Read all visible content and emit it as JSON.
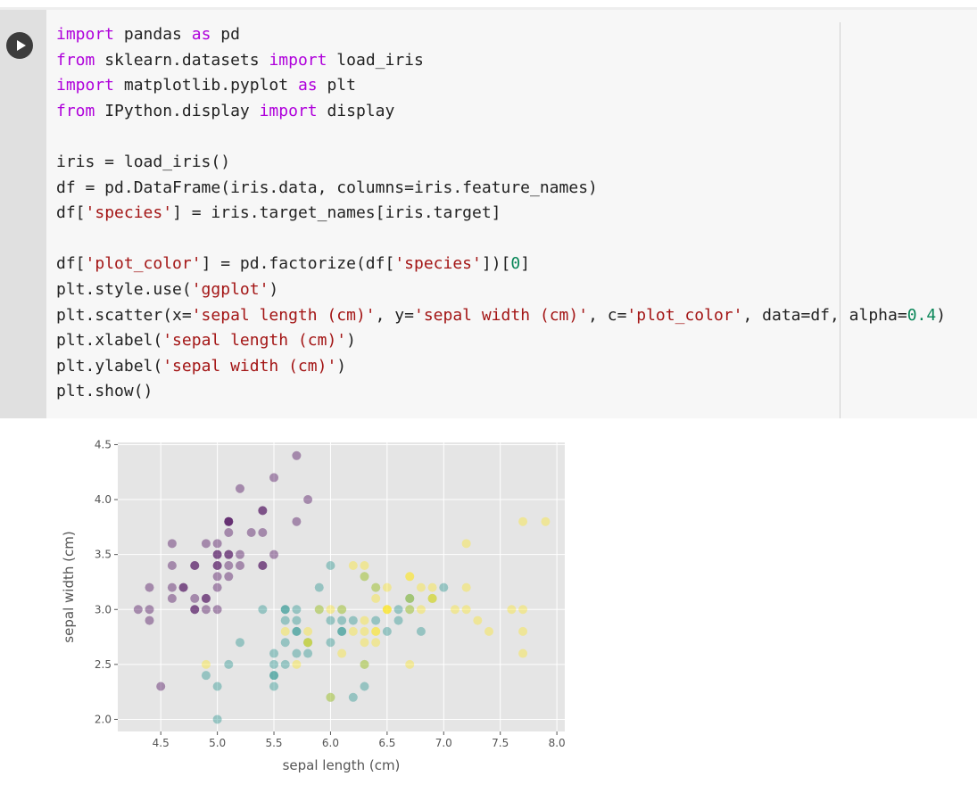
{
  "cell": {
    "run_button": "play-icon",
    "code_lines": [
      [
        {
          "t": "import",
          "c": "kw"
        },
        {
          "t": " pandas ",
          "c": "plain"
        },
        {
          "t": "as",
          "c": "kw"
        },
        {
          "t": " pd",
          "c": "plain"
        }
      ],
      [
        {
          "t": "from",
          "c": "kw"
        },
        {
          "t": " sklearn.datasets ",
          "c": "plain"
        },
        {
          "t": "import",
          "c": "kw"
        },
        {
          "t": " load_iris",
          "c": "plain"
        }
      ],
      [
        {
          "t": "import",
          "c": "kw"
        },
        {
          "t": " matplotlib.pyplot ",
          "c": "plain"
        },
        {
          "t": "as",
          "c": "kw"
        },
        {
          "t": " plt",
          "c": "plain"
        }
      ],
      [
        {
          "t": "from",
          "c": "kw"
        },
        {
          "t": " IPython.display ",
          "c": "plain"
        },
        {
          "t": "import",
          "c": "kw"
        },
        {
          "t": " display",
          "c": "plain"
        }
      ],
      [],
      [
        {
          "t": "iris = load_iris()",
          "c": "plain"
        }
      ],
      [
        {
          "t": "df = pd.DataFrame(iris.data, columns=iris.feature_names)",
          "c": "plain"
        }
      ],
      [
        {
          "t": "df[",
          "c": "plain"
        },
        {
          "t": "'species'",
          "c": "str"
        },
        {
          "t": "] = iris.target_names[iris.target]",
          "c": "plain"
        }
      ],
      [],
      [
        {
          "t": "df[",
          "c": "plain"
        },
        {
          "t": "'plot_color'",
          "c": "str"
        },
        {
          "t": "] = pd.factorize(df[",
          "c": "plain"
        },
        {
          "t": "'species'",
          "c": "str"
        },
        {
          "t": "])[",
          "c": "plain"
        },
        {
          "t": "0",
          "c": "num"
        },
        {
          "t": "]",
          "c": "plain"
        }
      ],
      [
        {
          "t": "plt.style.use(",
          "c": "plain"
        },
        {
          "t": "'ggplot'",
          "c": "str"
        },
        {
          "t": ")",
          "c": "plain"
        }
      ],
      [
        {
          "t": "plt.scatter(x=",
          "c": "plain"
        },
        {
          "t": "'sepal length (cm)'",
          "c": "str"
        },
        {
          "t": ", y=",
          "c": "plain"
        },
        {
          "t": "'sepal width (cm)'",
          "c": "str"
        },
        {
          "t": ", c=",
          "c": "plain"
        },
        {
          "t": "'plot_color'",
          "c": "str"
        },
        {
          "t": ", data=df, alpha=",
          "c": "plain"
        },
        {
          "t": "0.4",
          "c": "num"
        },
        {
          "t": ")",
          "c": "plain"
        }
      ],
      [
        {
          "t": "plt.xlabel(",
          "c": "plain"
        },
        {
          "t": "'sepal length (cm)'",
          "c": "str"
        },
        {
          "t": ")",
          "c": "plain"
        }
      ],
      [
        {
          "t": "plt.ylabel(",
          "c": "plain"
        },
        {
          "t": "'sepal width (cm)'",
          "c": "str"
        },
        {
          "t": ")",
          "c": "plain"
        }
      ],
      [
        {
          "t": "plt.show()",
          "c": "plain"
        }
      ]
    ]
  },
  "chart_data": {
    "type": "scatter",
    "xlabel": "sepal length (cm)",
    "ylabel": "sepal width (cm)",
    "xlim": [
      4.12,
      8.07
    ],
    "ylim": [
      1.89,
      4.52
    ],
    "xticks": [
      "4.5",
      "5.0",
      "5.5",
      "6.0",
      "6.5",
      "7.0",
      "7.5",
      "8.0"
    ],
    "yticks": [
      "2.0",
      "2.5",
      "3.0",
      "3.5",
      "4.0",
      "4.5"
    ],
    "grid": true,
    "style": "ggplot",
    "alpha": 0.4,
    "colors": [
      "#440154",
      "#21918c",
      "#fde725"
    ],
    "background": "#e5e5e5",
    "series": [
      {
        "color_index": 0,
        "points": [
          [
            5.1,
            3.5
          ],
          [
            4.9,
            3.0
          ],
          [
            4.7,
            3.2
          ],
          [
            4.6,
            3.1
          ],
          [
            5.0,
            3.6
          ],
          [
            5.4,
            3.9
          ],
          [
            4.6,
            3.4
          ],
          [
            5.0,
            3.4
          ],
          [
            4.4,
            2.9
          ],
          [
            4.9,
            3.1
          ],
          [
            5.4,
            3.7
          ],
          [
            4.8,
            3.4
          ],
          [
            4.8,
            3.0
          ],
          [
            4.3,
            3.0
          ],
          [
            5.8,
            4.0
          ],
          [
            5.7,
            4.4
          ],
          [
            5.4,
            3.9
          ],
          [
            5.1,
            3.5
          ],
          [
            5.7,
            3.8
          ],
          [
            5.1,
            3.8
          ],
          [
            5.4,
            3.4
          ],
          [
            5.1,
            3.7
          ],
          [
            4.6,
            3.6
          ],
          [
            5.1,
            3.3
          ],
          [
            4.8,
            3.4
          ],
          [
            5.0,
            3.0
          ],
          [
            5.0,
            3.4
          ],
          [
            5.2,
            3.5
          ],
          [
            5.2,
            3.4
          ],
          [
            4.7,
            3.2
          ],
          [
            4.8,
            3.1
          ],
          [
            5.4,
            3.4
          ],
          [
            5.2,
            4.1
          ],
          [
            5.5,
            4.2
          ],
          [
            4.9,
            3.1
          ],
          [
            5.0,
            3.2
          ],
          [
            5.5,
            3.5
          ],
          [
            4.9,
            3.6
          ],
          [
            4.4,
            3.0
          ],
          [
            5.1,
            3.4
          ],
          [
            5.0,
            3.5
          ],
          [
            4.5,
            2.3
          ],
          [
            4.4,
            3.2
          ],
          [
            5.0,
            3.5
          ],
          [
            5.1,
            3.8
          ],
          [
            4.8,
            3.0
          ],
          [
            5.1,
            3.8
          ],
          [
            4.6,
            3.2
          ],
          [
            5.3,
            3.7
          ],
          [
            5.0,
            3.3
          ]
        ]
      },
      {
        "color_index": 1,
        "points": [
          [
            7.0,
            3.2
          ],
          [
            6.4,
            3.2
          ],
          [
            6.9,
            3.1
          ],
          [
            5.5,
            2.3
          ],
          [
            6.5,
            2.8
          ],
          [
            5.7,
            2.8
          ],
          [
            6.3,
            3.3
          ],
          [
            4.9,
            2.4
          ],
          [
            6.6,
            2.9
          ],
          [
            5.2,
            2.7
          ],
          [
            5.0,
            2.0
          ],
          [
            5.9,
            3.0
          ],
          [
            6.0,
            2.2
          ],
          [
            6.1,
            2.9
          ],
          [
            5.6,
            2.9
          ],
          [
            6.7,
            3.1
          ],
          [
            5.6,
            3.0
          ],
          [
            5.8,
            2.7
          ],
          [
            6.2,
            2.2
          ],
          [
            5.6,
            2.5
          ],
          [
            5.9,
            3.2
          ],
          [
            6.1,
            2.8
          ],
          [
            6.3,
            2.5
          ],
          [
            6.1,
            2.8
          ],
          [
            6.4,
            2.9
          ],
          [
            6.6,
            3.0
          ],
          [
            6.8,
            2.8
          ],
          [
            6.7,
            3.0
          ],
          [
            6.0,
            2.9
          ],
          [
            5.7,
            2.6
          ],
          [
            5.5,
            2.4
          ],
          [
            5.5,
            2.4
          ],
          [
            5.8,
            2.7
          ],
          [
            6.0,
            2.7
          ],
          [
            5.4,
            3.0
          ],
          [
            6.0,
            3.4
          ],
          [
            6.7,
            3.1
          ],
          [
            6.3,
            2.3
          ],
          [
            5.6,
            3.0
          ],
          [
            5.5,
            2.5
          ],
          [
            5.5,
            2.6
          ],
          [
            6.1,
            3.0
          ],
          [
            5.8,
            2.6
          ],
          [
            5.0,
            2.3
          ],
          [
            5.6,
            2.7
          ],
          [
            5.7,
            3.0
          ],
          [
            5.7,
            2.9
          ],
          [
            6.2,
            2.9
          ],
          [
            5.1,
            2.5
          ],
          [
            5.7,
            2.8
          ]
        ]
      },
      {
        "color_index": 2,
        "points": [
          [
            6.3,
            3.3
          ],
          [
            5.8,
            2.7
          ],
          [
            7.1,
            3.0
          ],
          [
            6.3,
            2.9
          ],
          [
            6.5,
            3.0
          ],
          [
            7.6,
            3.0
          ],
          [
            4.9,
            2.5
          ],
          [
            7.3,
            2.9
          ],
          [
            6.7,
            2.5
          ],
          [
            7.2,
            3.6
          ],
          [
            6.5,
            3.2
          ],
          [
            6.4,
            2.7
          ],
          [
            6.8,
            3.0
          ],
          [
            5.7,
            2.5
          ],
          [
            5.8,
            2.8
          ],
          [
            6.4,
            3.2
          ],
          [
            6.5,
            3.0
          ],
          [
            7.7,
            3.8
          ],
          [
            7.7,
            2.6
          ],
          [
            6.0,
            2.2
          ],
          [
            6.9,
            3.2
          ],
          [
            5.6,
            2.8
          ],
          [
            7.7,
            2.8
          ],
          [
            6.3,
            2.7
          ],
          [
            6.7,
            3.3
          ],
          [
            7.2,
            3.2
          ],
          [
            6.2,
            2.8
          ],
          [
            6.1,
            3.0
          ],
          [
            6.4,
            2.8
          ],
          [
            7.2,
            3.0
          ],
          [
            7.4,
            2.8
          ],
          [
            7.9,
            3.8
          ],
          [
            6.4,
            2.8
          ],
          [
            6.3,
            2.8
          ],
          [
            6.1,
            2.6
          ],
          [
            7.7,
            3.0
          ],
          [
            6.3,
            3.4
          ],
          [
            6.4,
            3.1
          ],
          [
            6.0,
            3.0
          ],
          [
            6.9,
            3.1
          ],
          [
            6.7,
            3.1
          ],
          [
            6.9,
            3.1
          ],
          [
            5.8,
            2.7
          ],
          [
            6.8,
            3.2
          ],
          [
            6.7,
            3.3
          ],
          [
            6.7,
            3.0
          ],
          [
            6.3,
            2.5
          ],
          [
            6.5,
            3.0
          ],
          [
            6.2,
            3.4
          ],
          [
            5.9,
            3.0
          ]
        ]
      }
    ]
  }
}
